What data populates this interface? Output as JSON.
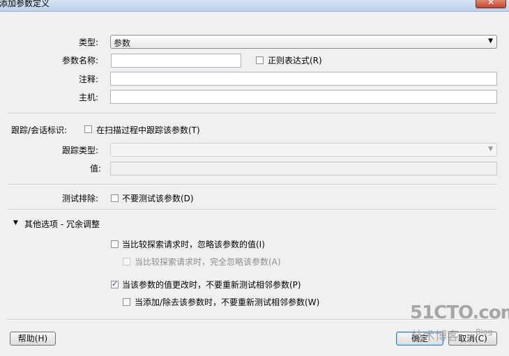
{
  "window": {
    "title": "添加参数定义",
    "close_label": "✕"
  },
  "form": {
    "type_label": "类型:",
    "type_value": "参数",
    "name_label": "参数名称:",
    "name_value": "",
    "regex_label": "正则表达式(R)",
    "regex_checked": false,
    "comment_label": "注释:",
    "comment_value": "",
    "host_label": "主机:",
    "host_value": ""
  },
  "tracking": {
    "label": "跟踪/会话标识:",
    "checkbox_label": "在扫描过程中跟踪该参数(T)",
    "type_label": "跟踪类型:",
    "type_value": "",
    "value_label": "值:",
    "value_value": ""
  },
  "exclude": {
    "label": "测试排除:",
    "checkbox_label": "不要测试该参数(D)"
  },
  "other": {
    "header": "其他选项 - 冗余调整",
    "expanded": true,
    "opt1": "当比较探索请求时，忽略该参数的值(I)",
    "opt2": "当比较探索请求时，完全忽略该参数(A)",
    "opt3": "当该参数的值更改时，不要重新测试相邻参数(P)",
    "opt4": "当添加/除去该参数时，不要重新测试相邻参数(W)"
  },
  "buttons": {
    "help": "帮助(H)",
    "ok": "确定",
    "cancel": "取消(C)"
  },
  "watermark": {
    "line1": "51CTO.com",
    "line2": "技术博客",
    "line3": "Blog"
  }
}
